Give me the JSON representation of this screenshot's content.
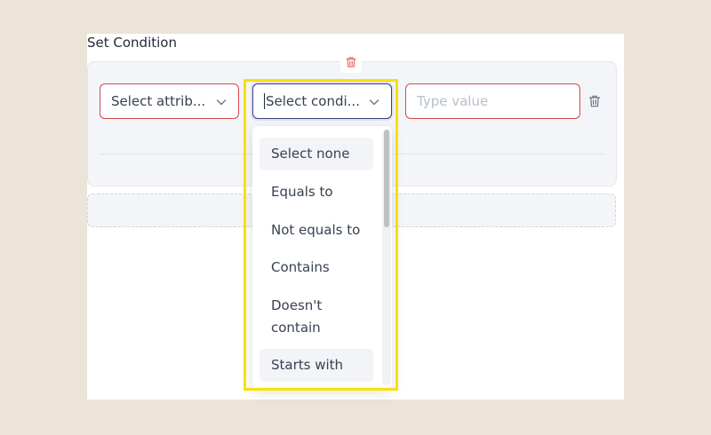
{
  "section": {
    "title": "Set Condition"
  },
  "condition_row": {
    "attribute_select": {
      "value": "Select attrib..."
    },
    "condition_select": {
      "value": "Select condi..."
    },
    "value_input": {
      "placeholder": "Type value"
    }
  },
  "condition_dropdown": {
    "options": [
      {
        "label": "Select none"
      },
      {
        "label": "Equals to"
      },
      {
        "label": "Not equals to"
      },
      {
        "label": "Contains"
      },
      {
        "label": "Doesn't\ncontain"
      },
      {
        "label": "Starts with"
      }
    ]
  },
  "colors": {
    "error_border": "#d4484d",
    "focus_border": "#3d3c8a",
    "highlight": "#f9e000",
    "delete_icon": "#e06b6b"
  },
  "icons": {
    "group_delete": "trash-icon",
    "row_delete": "trash-icon",
    "dropdown_arrow": "chevron-down-icon"
  }
}
